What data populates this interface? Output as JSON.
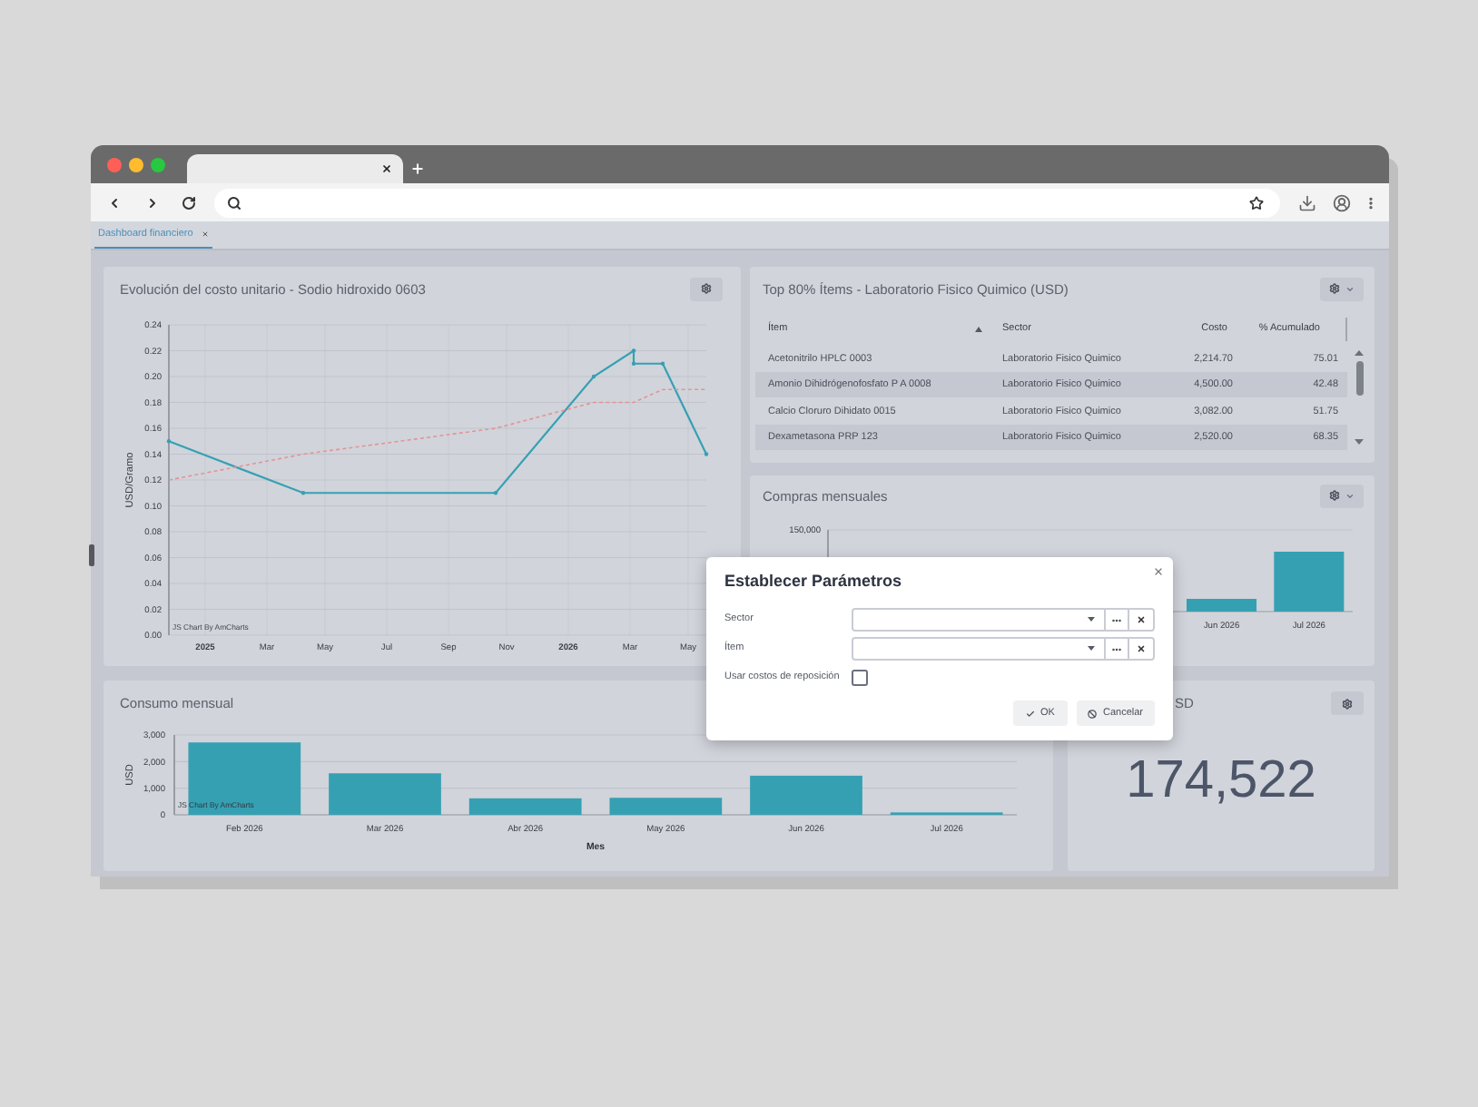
{
  "app_tabs": [
    {
      "label": "Dashboard financiero",
      "selected": true
    }
  ],
  "cost_chart": {
    "title": "Evolución del costo unitario - Sodio hidroxido 0603",
    "settings": {
      "dropdown": false
    },
    "credit": "JS Chart By AmCharts",
    "chart_data": {
      "type": "line",
      "ylabel": "USD/Gramo",
      "grid": true,
      "x": [
        2024.9,
        2025.27,
        2025.8,
        2026.07,
        2026.18,
        2026.18,
        2026.26,
        2026.38
      ],
      "series": [
        {
          "color": "#36a0b3",
          "line_style": "solid",
          "values": [
            0.15,
            0.11,
            0.11,
            0.2,
            0.22,
            0.21,
            0.21,
            0.14
          ]
        },
        {
          "color": "#e39494",
          "line_style": "dashed",
          "values": [
            0.12,
            0.14,
            0.16,
            0.18,
            0.18,
            0.18,
            0.19,
            0.19
          ]
        }
      ],
      "xlim": [
        2024.9,
        2026.38
      ],
      "ylim": [
        0,
        0.24
      ],
      "xticks": [
        {
          "value": 2025,
          "label": "2025"
        },
        {
          "value": 2025.17,
          "label": "Mar"
        },
        {
          "value": 2025.33,
          "label": "May"
        },
        {
          "value": 2025.5,
          "label": "Jul"
        },
        {
          "value": 2025.67,
          "label": "Sep"
        },
        {
          "value": 2025.83,
          "label": "Nov"
        },
        {
          "value": 2026,
          "label": "2026"
        },
        {
          "value": 2026.17,
          "label": "Mar"
        },
        {
          "value": 2026.33,
          "label": "May"
        }
      ],
      "yticks": [
        {
          "value": 0,
          "label": "0.00"
        },
        {
          "value": 0.02,
          "label": "0.02"
        },
        {
          "value": 0.04,
          "label": "0.04"
        },
        {
          "value": 0.06,
          "label": "0.06"
        },
        {
          "value": 0.08,
          "label": "0.08"
        },
        {
          "value": 0.1,
          "label": "0.10"
        },
        {
          "value": 0.12,
          "label": "0.12"
        },
        {
          "value": 0.14,
          "label": "0.14"
        },
        {
          "value": 0.16,
          "label": "0.16"
        },
        {
          "value": 0.18,
          "label": "0.18"
        },
        {
          "value": 0.2,
          "label": "0.20"
        },
        {
          "value": 0.22,
          "label": "0.22"
        },
        {
          "value": 0.24,
          "label": "0.24"
        }
      ]
    }
  },
  "top_items": {
    "title": "Top 80% Ítems - Laboratorio Fisico Quimico (USD)",
    "settings": {
      "dropdown": true
    },
    "columns": [
      {
        "label": "Ítem",
        "sorted": true
      },
      {
        "label": "Sector",
        "sorted": false
      },
      {
        "label": "Costo",
        "sorted": false
      },
      {
        "label": "% Acumulado",
        "sorted": false
      }
    ],
    "rows": [
      [
        "Acetonitrilo HPLC 0003",
        "Laboratorio Fisico Quimico",
        "2,214.70",
        "75.01"
      ],
      [
        "Amonio Dihidrógenofosfato P A 0008",
        "Laboratorio Fisico Quimico",
        "4,500.00",
        "42.48"
      ],
      [
        "Calcio Cloruro Dihidato 0015",
        "Laboratorio Fisico Quimico",
        "3,082.00",
        "51.75"
      ],
      [
        "Dexametasona PRP 123",
        "Laboratorio Fisico Quimico",
        "2,520.00",
        "68.35"
      ]
    ]
  },
  "purchases_chart": {
    "title": "Compras mensuales",
    "settings": {
      "dropdown": true
    },
    "axis_label": "150,000",
    "month_labels": [
      "Jun 2026",
      "Jul 2026"
    ]
  },
  "consumption_chart": {
    "title": "Consumo mensual",
    "credit": "JS Chart By AmCharts",
    "chart_data": {
      "type": "bar",
      "xlabel": "Mes",
      "ylabel": "USD",
      "grid": true,
      "categories": [
        "Feb 2026",
        "Mar 2026",
        "Abr 2026",
        "May 2026",
        "Jun 2026",
        "Jul 2026"
      ],
      "series": [
        {
          "color": "#36a0b3",
          "values": [
            2720,
            1560,
            620,
            640,
            1470,
            90
          ]
        }
      ],
      "ylim": [
        0,
        3000
      ],
      "yticks": [
        {
          "value": 0,
          "label": "0"
        },
        {
          "value": 1000,
          "label": "1,000"
        },
        {
          "value": 2000,
          "label": "2,000"
        },
        {
          "value": 3000,
          "label": "3,000"
        }
      ]
    }
  },
  "total_card": {
    "title": "SD",
    "settings": {
      "dropdown": false
    },
    "value": "174,522"
  },
  "dialog": {
    "title": "Establecer Parámetros",
    "fields": [
      {
        "kind": "select",
        "label": "Sector"
      },
      {
        "kind": "select",
        "label": "Ítem"
      },
      {
        "kind": "checkbox",
        "label": "Usar costos de reposición",
        "checked": false
      }
    ],
    "buttons": [
      {
        "kind": "confirm",
        "label": "OK"
      },
      {
        "kind": "cancel",
        "label": "Cancelar"
      }
    ]
  }
}
